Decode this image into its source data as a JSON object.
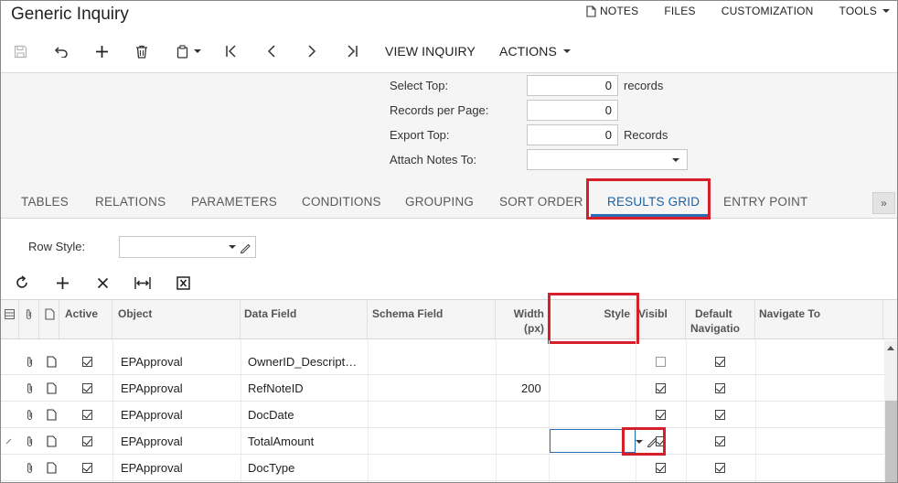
{
  "header": {
    "title": "Generic Inquiry",
    "links": [
      {
        "label": "NOTES",
        "icon": "note-icon"
      },
      {
        "label": "FILES"
      },
      {
        "label": "CUSTOMIZATION"
      },
      {
        "label": "TOOLS",
        "dropdown": true
      }
    ]
  },
  "toolbar": {
    "icons": [
      "save-icon",
      "undo-icon",
      "add-icon",
      "delete-icon",
      "copy-paste-icon",
      "first-record-icon",
      "previous-record-icon",
      "next-record-icon",
      "last-record-icon"
    ],
    "view_inquiry": "VIEW INQUIRY",
    "actions": "ACTIONS"
  },
  "form": {
    "select_top": {
      "label": "Select Top:",
      "value": "0",
      "suffix": "records"
    },
    "records_per_page": {
      "label": "Records per Page:",
      "value": "0"
    },
    "export_top": {
      "label": "Export Top:",
      "value": "0",
      "suffix": "Records"
    },
    "attach_notes_to": {
      "label": "Attach Notes To:",
      "value": ""
    }
  },
  "tabs": [
    "TABLES",
    "RELATIONS",
    "PARAMETERS",
    "CONDITIONS",
    "GROUPING",
    "SORT ORDER",
    "RESULTS GRID",
    "ENTRY POINT"
  ],
  "active_tab": "RESULTS GRID",
  "tab_scroll_glyph": "»",
  "row_style": {
    "label": "Row Style:",
    "value": ""
  },
  "grid_toolbar": [
    "refresh-icon",
    "add-row-icon",
    "delete-row-icon",
    "fit-to-screen-icon",
    "export-excel-icon"
  ],
  "grid": {
    "columns": {
      "active": "Active",
      "object": "Object",
      "data_field": "Data Field",
      "schema_field": "Schema Field",
      "width_line1": "Width",
      "width_line2": "(px)",
      "style": "Style",
      "visible": "Visibl",
      "default_nav_line1": "Default",
      "default_nav_line2": "Navigatio",
      "navigate_to": "Navigate To"
    },
    "rows": [
      {
        "active": true,
        "object": "EPApproval",
        "data_field": "OwnerID_Descript…",
        "width": "",
        "visible": false,
        "default_nav": true
      },
      {
        "active": true,
        "object": "EPApproval",
        "data_field": "RefNoteID",
        "width": "200",
        "visible": true,
        "default_nav": true
      },
      {
        "active": true,
        "object": "EPApproval",
        "data_field": "DocDate",
        "width": "",
        "visible": true,
        "default_nav": true
      },
      {
        "active": true,
        "object": "EPApproval",
        "data_field": "TotalAmount",
        "width": "",
        "visible": true,
        "default_nav": true,
        "editing": true
      },
      {
        "active": true,
        "object": "EPApproval",
        "data_field": "DocType",
        "width": "",
        "visible": true,
        "default_nav": true
      }
    ]
  },
  "highlight_color": "#d51f2b",
  "accent_color": "#1a5fa8"
}
